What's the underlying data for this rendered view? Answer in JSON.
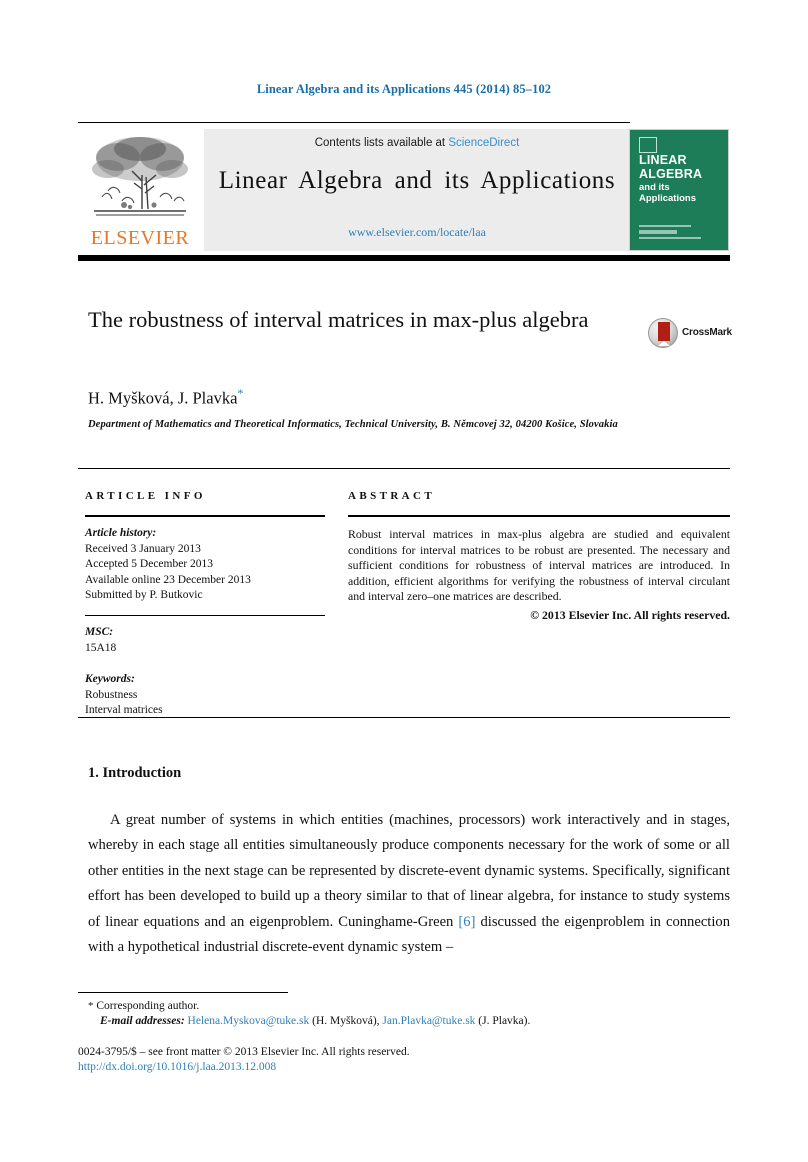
{
  "running_head": "Linear Algebra and its Applications 445 (2014) 85–102",
  "masthead": {
    "contents_prefix": "Contents lists available at ",
    "sciencedirect": "ScienceDirect",
    "journal_title": "Linear Algebra and its Applications",
    "journal_url": "www.elsevier.com/locate/laa",
    "publisher_wordmark": "ELSEVIER",
    "cover": {
      "line1": "LINEAR",
      "line2": "ALGEBRA",
      "line3": "and its",
      "line4": "Applications"
    }
  },
  "article": {
    "title": "The robustness of interval matrices in max-plus algebra",
    "crossmark_label": "CrossMark",
    "authors": "H. Myšková, J. Plavka",
    "corresponding_marker": "*",
    "affiliation": "Department of Mathematics and Theoretical Informatics, Technical University, B. Němcovej 32, 04200 Košice, Slovakia"
  },
  "article_info": {
    "heading": "ARTICLE INFO",
    "history_label": "Article history:",
    "history": [
      "Received 3 January 2013",
      "Accepted 5 December 2013",
      "Available online 23 December 2013",
      "Submitted by P. Butkovic"
    ],
    "msc_label": "MSC:",
    "msc": "15A18",
    "keywords_label": "Keywords:",
    "keywords": [
      "Robustness",
      "Interval matrices"
    ]
  },
  "abstract": {
    "heading": "ABSTRACT",
    "text": "Robust interval matrices in max-plus algebra are studied and equivalent conditions for interval matrices to be robust are presented. The necessary and sufficient conditions for robustness of interval matrices are introduced. In addition, efficient algorithms for verifying the robustness of interval circulant and interval zero–one matrices are described.",
    "copyright": "© 2013 Elsevier Inc. All rights reserved."
  },
  "body": {
    "section_title": "1. Introduction",
    "paragraph_part1": "A great number of systems in which entities (machines, processors) work interactively and in stages, whereby in each stage all entities simultaneously produce components necessary for the work of some or all other entities in the next stage can be represented by discrete-event dynamic systems. Specifically, significant effort has been developed to build up a theory similar to that of linear algebra, for instance to study systems of linear equations and an eigenproblem. Cuninghame-Green ",
    "citation": "[6]",
    "paragraph_part2": " discussed the eigenproblem in connection with a hypothetical industrial discrete-event dynamic system –"
  },
  "footnotes": {
    "corresponding_star": "*",
    "corresponding_text": "Corresponding author.",
    "email_label": "E-mail addresses:",
    "email1": "Helena.Myskova@tuke.sk",
    "email1_author": "(H. Myšková),",
    "email2": "Jan.Plavka@tuke.sk",
    "email2_author": "(J. Plavka).",
    "front_matter": "0024-3795/$ – see front matter © 2013 Elsevier Inc. All rights reserved.",
    "doi": "http://dx.doi.org/10.1016/j.laa.2013.12.008"
  },
  "colors": {
    "link_blue": "#2f7fb8",
    "header_blue": "#1a6ea8",
    "elsevier_orange": "#E87722",
    "cover_green": "#1d7d58",
    "crossmark_red": "#b01f13"
  }
}
